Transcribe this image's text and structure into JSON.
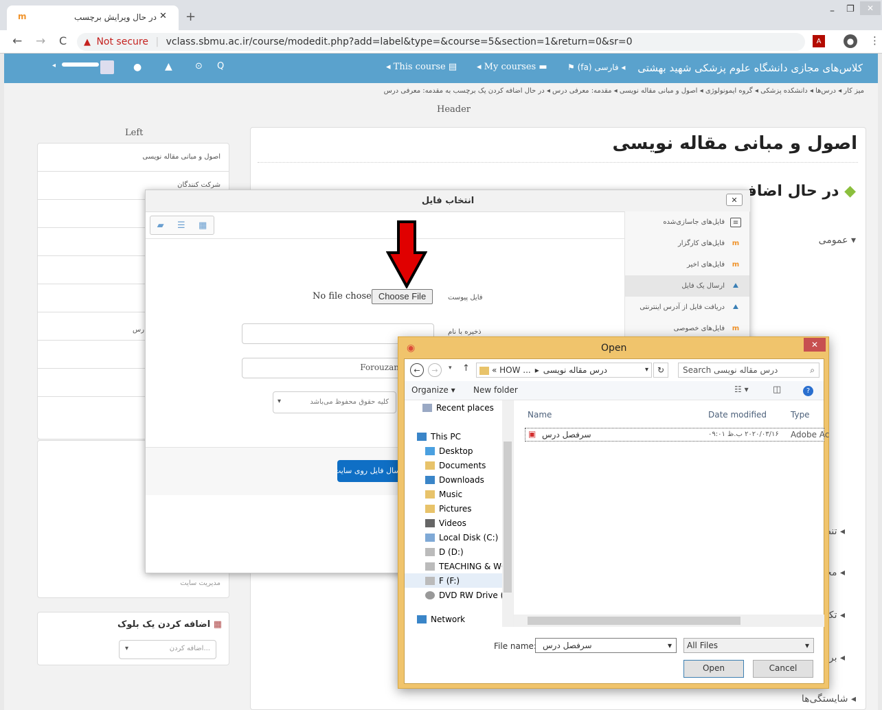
{
  "browser": {
    "tab_title": "در حال ویرایش برچسب",
    "url_warning": "Not secure",
    "url": "vclass.sbmu.ac.ir/course/modedit.php?add=label&type=&course=5&section=1&return=0&sr=0"
  },
  "navbar": {
    "site_name": "کلاس‌های مجازی دانشگاه علوم پزشکی شهید بهشتی",
    "lang": "فارسی (fa)",
    "my_courses": "My courses",
    "this_course": "This course"
  },
  "breadcrumb": "میز کار ◂ درس‌ها ◂ دانشکده پزشکی ◂ گروه ایمونولوژی ◂ اصول و مبانی مقاله نویسی ◂ مقدمه: معرفی درس ◂ در حال اضافه کردن یک برچسب به مقدمه: معرفی درس",
  "header_label": "Header",
  "left_label": "Left",
  "left_block": {
    "items": [
      "اصول و مبانی مقاله نویسی",
      "شرکت کنندگان",
      "",
      "",
      "",
      "",
      "رس",
      "",
      "",
      "",
      "",
      "",
      "",
      "مدیریت سایت"
    ]
  },
  "add_block": {
    "title": "اضافه کردن یک بلوک",
    "select": "اضافه کردن..."
  },
  "course_title": "اصول و مبانی مقاله نویسی",
  "editing_title": "در حال اضافه",
  "sections": {
    "general": "عمومی",
    "s1": "تنظ",
    "s2": "محد",
    "s3": "تکم",
    "s4": "برچ",
    "s5": "شایستگی‌ها"
  },
  "filepicker": {
    "title": "انتخاب فایل",
    "repos": [
      "فایل‌های جاسازی‌شده",
      "فایل‌های کارگزار",
      "فایل‌های اخیر",
      "ارسال یک فایل",
      "دریافت فایل از آدرس اینترنتی",
      "فایل‌های خصوصی"
    ],
    "attachment_label": "فایل پیوست",
    "no_file": "No file chosen",
    "choose_file": "Choose File",
    "save_as_label": "ذخیره با نام",
    "author_value": "Forouzan",
    "license_value": "کلیه حقوق محفوظ می‌باشد",
    "upload_button": "ارسال فایل روی سایت"
  },
  "open_dialog": {
    "title": "Open",
    "path_prefix": "«  HOW ...",
    "path_current": "درس مقاله نویسی",
    "search_placeholder": "Search درس مقاله نویسی",
    "organize": "Organize",
    "new_folder": "New folder",
    "tree": [
      "Recent places",
      "This PC",
      "Desktop",
      "Documents",
      "Downloads",
      "Music",
      "Pictures",
      "Videos",
      "Local Disk (C:)",
      "D (D:)",
      "TEACHING & WC",
      "F (F:)",
      "DVD RW Drive (H",
      "Network"
    ],
    "columns": {
      "name": "Name",
      "date": "Date modified",
      "type": "Type"
    },
    "file": {
      "name": "سرفصل درس",
      "date": "۲۰۲۰/۰۳/۱۶ ب.ظ ۰۹:۰۱",
      "type": "Adobe Ac"
    },
    "filename_label": "File name:",
    "filename_value": "سرفصل درس",
    "filter": "All Files",
    "open_button": "Open",
    "cancel_button": "Cancel"
  }
}
